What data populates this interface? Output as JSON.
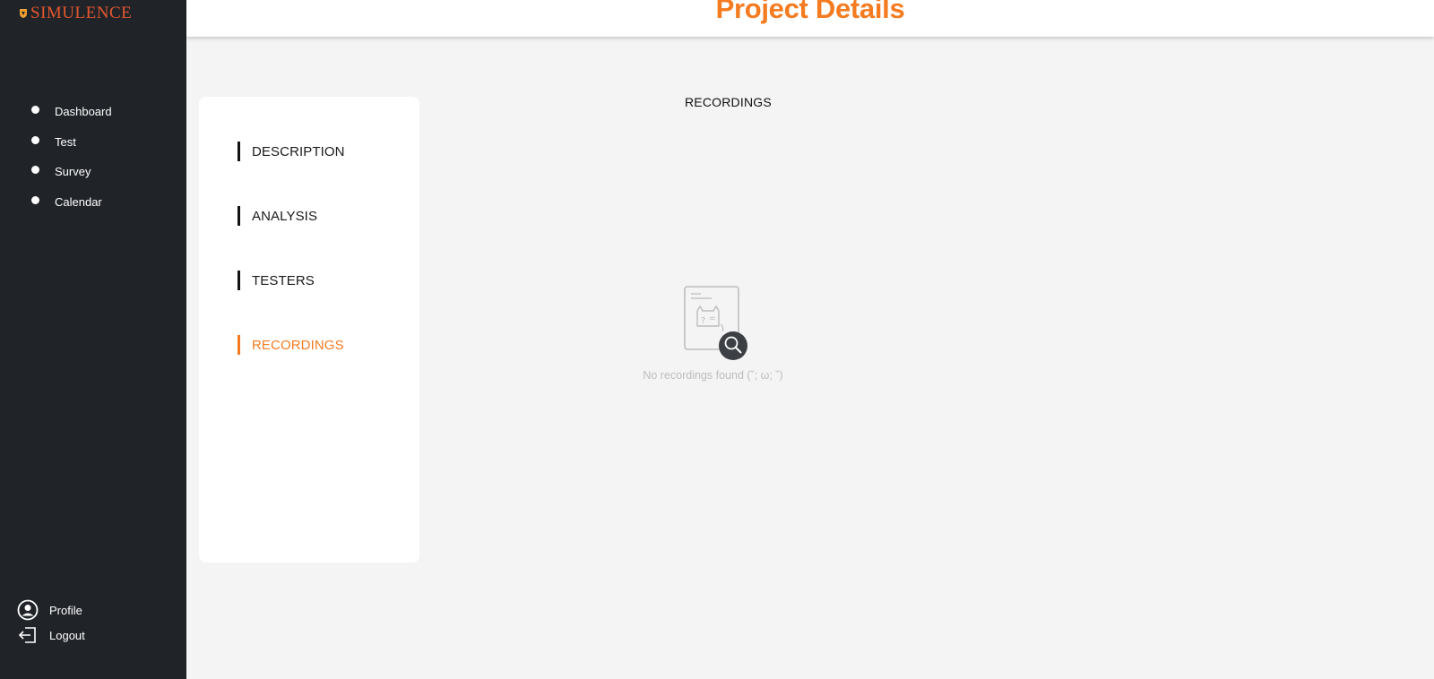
{
  "app": {
    "brand": "SIMULENCE"
  },
  "header": {
    "title": "Project Details"
  },
  "sidebar": {
    "items": [
      {
        "label": "Dashboard"
      },
      {
        "label": "Test"
      },
      {
        "label": "Survey"
      },
      {
        "label": "Calendar"
      }
    ],
    "bottom": [
      {
        "label": "Profile",
        "icon": "user-circle-icon"
      },
      {
        "label": "Logout",
        "icon": "logout-icon"
      }
    ]
  },
  "tabs": [
    {
      "label": "DESCRIPTION"
    },
    {
      "label": "ANALYSIS"
    },
    {
      "label": "TESTERS"
    },
    {
      "label": "RECORDINGS",
      "active": true
    }
  ],
  "main": {
    "section_title": "RECORDINGS",
    "empty_message": "No recordings found (˘; ω; ˘)"
  },
  "colors": {
    "accent": "#f47b20",
    "sidebar_bg": "#202328",
    "brand": "#e4572e",
    "page_bg": "#f4f4f4"
  }
}
